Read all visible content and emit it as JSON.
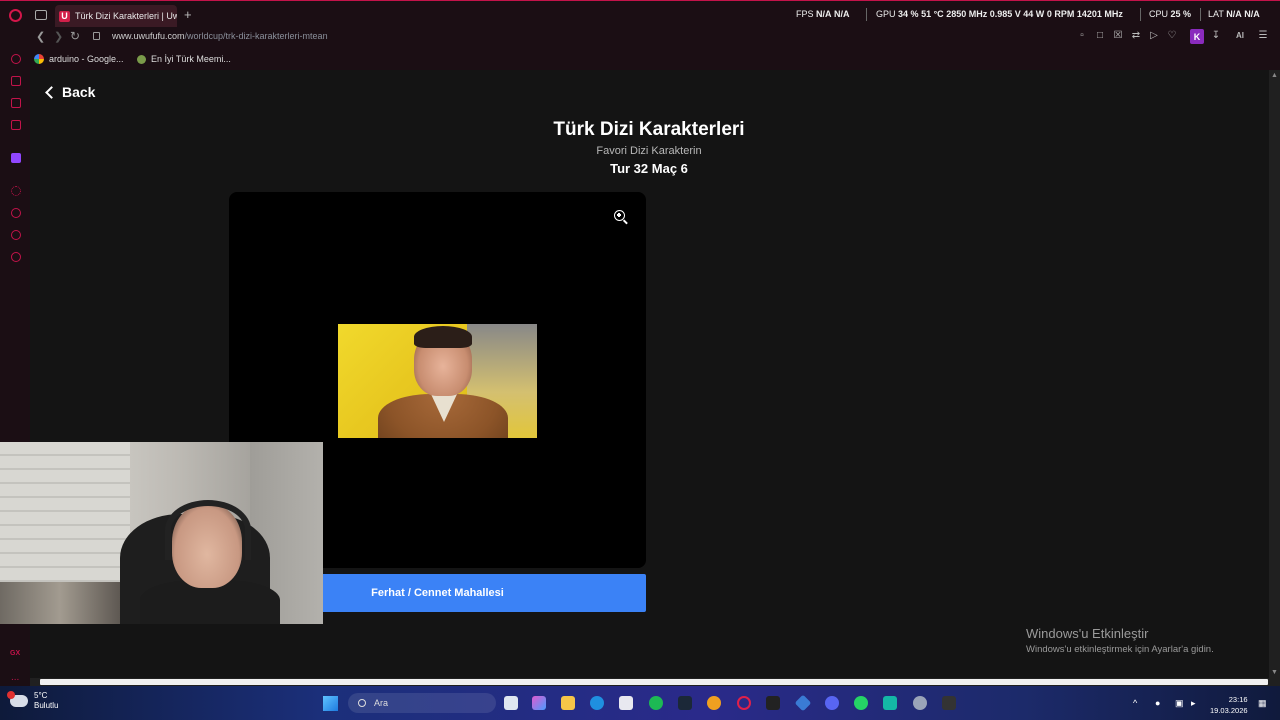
{
  "browser": {
    "active_tab_title": "Türk Dizi Karakterleri | Uw",
    "tab_favicon_letter": "U",
    "new_tab_symbol": "+",
    "url_host": "www.uwufufu.com",
    "url_path": "/worldcup/trk-dizi-karakterleri-mtean",
    "profile_letter": "K",
    "ai_label": "AI",
    "bookmarks": [
      {
        "label": "arduino - Google..."
      },
      {
        "label": "En İyi Türk Meemi..."
      }
    ]
  },
  "hud": {
    "fps_label": "FPS",
    "fps_value1": "N/A",
    "fps_value2": "N/A",
    "gpu_label": "GPU",
    "gpu_usage": "34 %",
    "gpu_temp": "51 °C",
    "gpu_clock": "2850 MHz",
    "gpu_voltage": "0.985 V",
    "gpu_power": "44 W",
    "gpu_fan": "0 RPM",
    "gpu_mem_clock": "14201 MHz",
    "cpu_label": "CPU",
    "cpu_usage": "25 %",
    "lat_label": "LAT",
    "lat_value1": "N/A",
    "lat_value2": "N/A"
  },
  "page": {
    "back_label": "Back",
    "title": "Türk Dizi Karakterleri",
    "subtitle": "Favori Dizi Karakterin",
    "round_info": "Tur 32 Maç 6",
    "choice_label": "Ferhat / Cennet Mahallesi"
  },
  "windows_activation": {
    "title": "Windows'u Etkinleştir",
    "message": "Windows'u etkinleştirmek için Ayarlar'a gidin."
  },
  "taskbar": {
    "temperature": "5°C",
    "weather_text": "Bulutlu",
    "search_placeholder": "Ara",
    "time": "23:16",
    "date": "19.03.2026",
    "tray_chevron": "^"
  },
  "sidebar": {
    "gx_label": "GX",
    "more_label": "..."
  },
  "colors": {
    "accent": "#c3134a",
    "choice_button": "#3b82f6",
    "page_bg": "#141414",
    "card_bg": "#000000"
  }
}
